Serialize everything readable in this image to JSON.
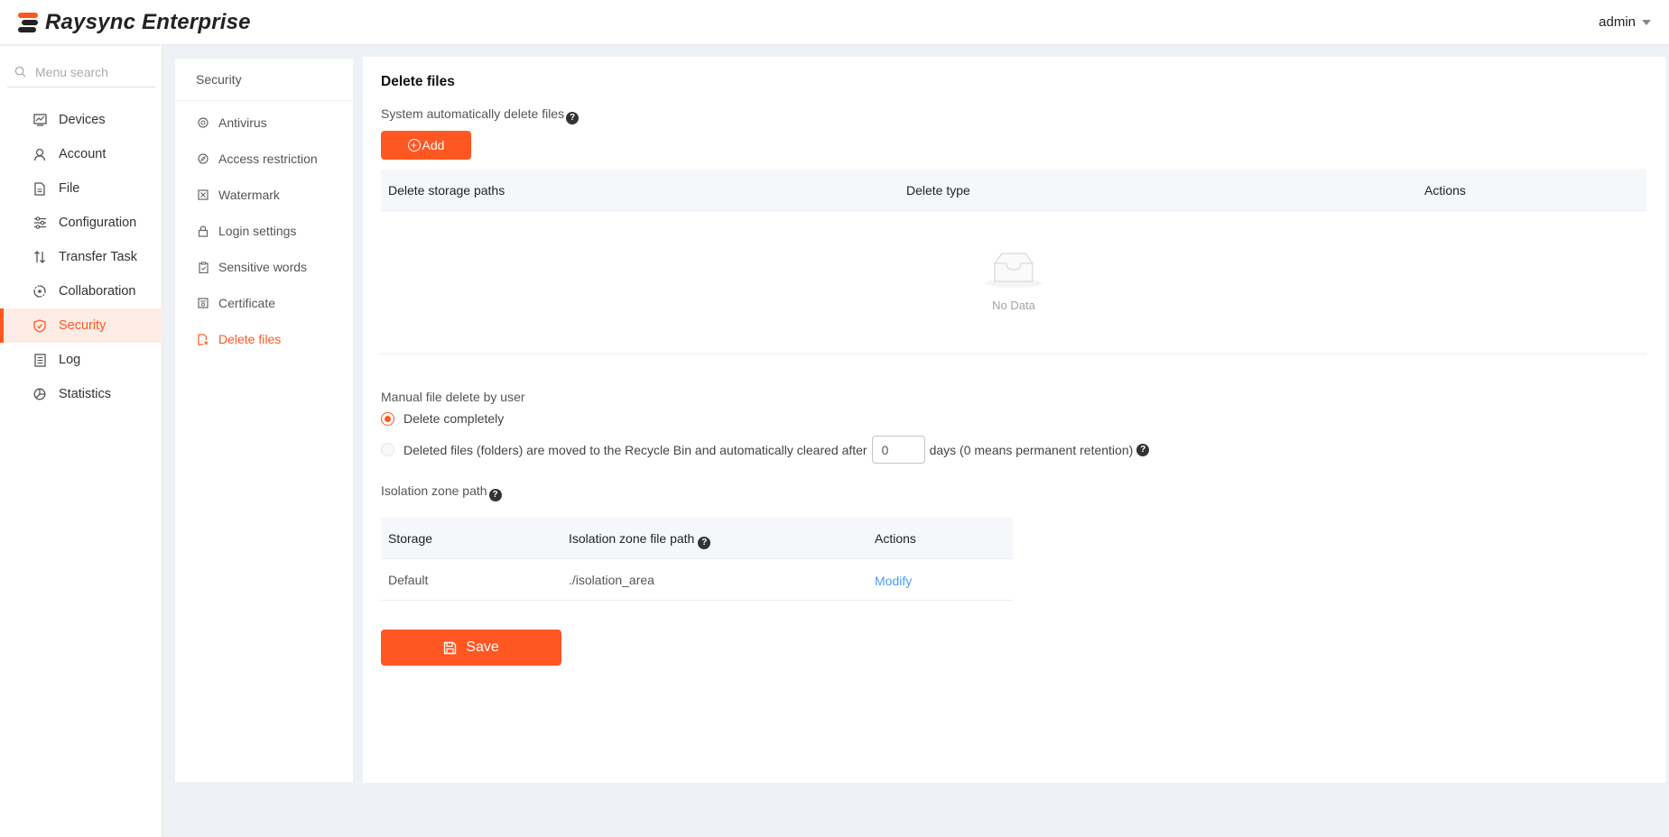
{
  "app": {
    "title": "Raysync Enterprise",
    "user": "admin",
    "accent_color": "#ff5722"
  },
  "sidebar": {
    "search_placeholder": "Menu search",
    "items": [
      {
        "label": "Devices",
        "icon": "monitor-chart-icon"
      },
      {
        "label": "Account",
        "icon": "user-icon"
      },
      {
        "label": "File",
        "icon": "file-icon"
      },
      {
        "label": "Configuration",
        "icon": "sliders-icon"
      },
      {
        "label": "Transfer Task",
        "icon": "transfer-arrows-icon"
      },
      {
        "label": "Collaboration",
        "icon": "collaboration-icon"
      },
      {
        "label": "Security",
        "icon": "shield-icon",
        "active": true
      },
      {
        "label": "Log",
        "icon": "log-icon"
      },
      {
        "label": "Statistics",
        "icon": "pie-chart-icon"
      }
    ]
  },
  "subpanel": {
    "title": "Security",
    "items": [
      {
        "label": "Antivirus",
        "icon": "virus-icon"
      },
      {
        "label": "Access restriction",
        "icon": "compass-icon"
      },
      {
        "label": "Watermark",
        "icon": "watermark-icon"
      },
      {
        "label": "Login settings",
        "icon": "lock-icon"
      },
      {
        "label": "Sensitive words",
        "icon": "clipboard-icon"
      },
      {
        "label": "Certificate",
        "icon": "certificate-icon"
      },
      {
        "label": "Delete files",
        "icon": "delete-file-icon",
        "active": true
      }
    ]
  },
  "main": {
    "title": "Delete files",
    "auto_delete_label": "System automatically delete files",
    "add_button": "Add",
    "auto_table": {
      "columns": [
        "Delete storage paths",
        "Delete type",
        "Actions"
      ],
      "empty_text": "No Data"
    },
    "manual_label": "Manual file delete by user",
    "option_complete": "Delete completely",
    "option_recycle_prefix": "Deleted files (folders) are moved to the Recycle Bin and automatically cleared after",
    "option_recycle_days": "0",
    "option_recycle_suffix": "days (0 means permanent retention)",
    "isolation_label": "Isolation zone path",
    "isolation_table": {
      "columns": [
        "Storage",
        "Isolation zone file path",
        "Actions"
      ],
      "rows": [
        {
          "storage": "Default",
          "path": "./isolation_area",
          "action": "Modify"
        }
      ]
    },
    "save_button": "Save"
  }
}
